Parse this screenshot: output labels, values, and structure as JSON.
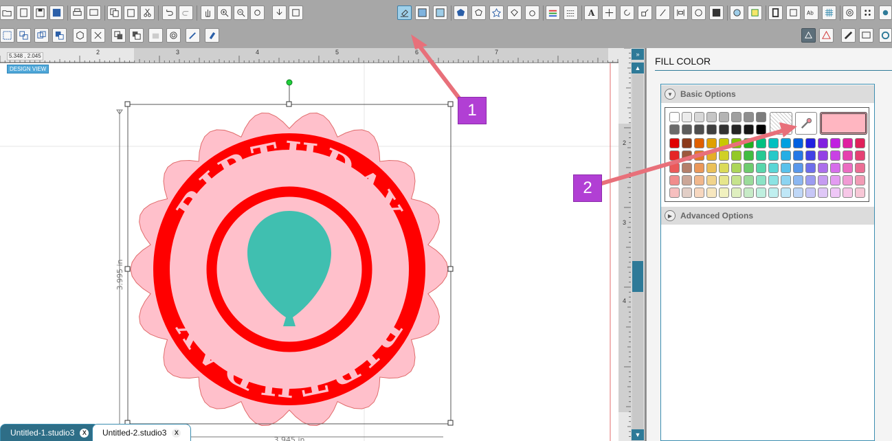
{
  "ruler": {
    "coords": "5.348 , 2.045",
    "top_numbers": [
      "2",
      "3",
      "4",
      "5",
      "6",
      "7"
    ],
    "right_numbers": [
      "2",
      "3",
      "4"
    ]
  },
  "canvas": {
    "design_view_label": "DESIGN VIEW",
    "height_label": "3.995 in",
    "width_label": "3.945 in",
    "badge_text": "BIRTHDAY",
    "colors": {
      "scallop": "#ffc0cb",
      "ring": "#ff0000",
      "balloon": "#40bfb0"
    }
  },
  "panel": {
    "title": "FILL COLOR",
    "basic_options_label": "Basic Options",
    "advanced_options_label": "Advanced Options",
    "selected_color": "#ffb6c1",
    "eyedropper_icon": "eyedropper-icon"
  },
  "annotations": {
    "marker_1": "1",
    "marker_2": "2"
  },
  "tabs": [
    {
      "label": "Untitled-1.studio3",
      "close": "X"
    },
    {
      "label": "Untitled-2.studio3",
      "close": "X"
    }
  ]
}
